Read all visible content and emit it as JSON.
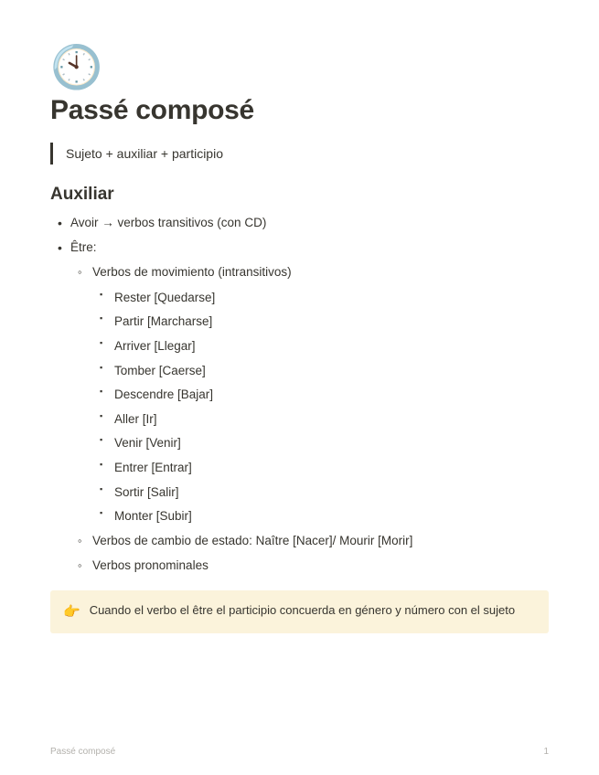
{
  "icon": "🕙",
  "title": "Passé composé",
  "quote": "Sujeto + auxiliar  + participio",
  "section_heading": "Auxiliar",
  "bullets": {
    "avoir": "Avoir → verbos transitivos (con CD)",
    "etre_label": "Être:",
    "etre_sub": {
      "movimiento_label": "Verbos de movimiento (intransitivos)",
      "movimiento_items": [
        "Rester [Quedarse]",
        "Partir [Marcharse]",
        "Arriver [Llegar]",
        "Tomber [Caerse]",
        "Descendre [Bajar]",
        "Aller [Ir]",
        "Venir [Venir]",
        "Entrer [Entrar]",
        "Sortir [Salir]",
        "Monter [Subir]"
      ],
      "cambio_estado": "Verbos de cambio de estado: Naître [Nacer]/ Mourir [Morir]",
      "pronominales": "Verbos pronominales"
    }
  },
  "callout": {
    "icon": "👉",
    "text": "Cuando el verbo el être el participio concuerda en género y número con el sujeto"
  },
  "footer": {
    "title": "Passé composé",
    "page": "1"
  }
}
